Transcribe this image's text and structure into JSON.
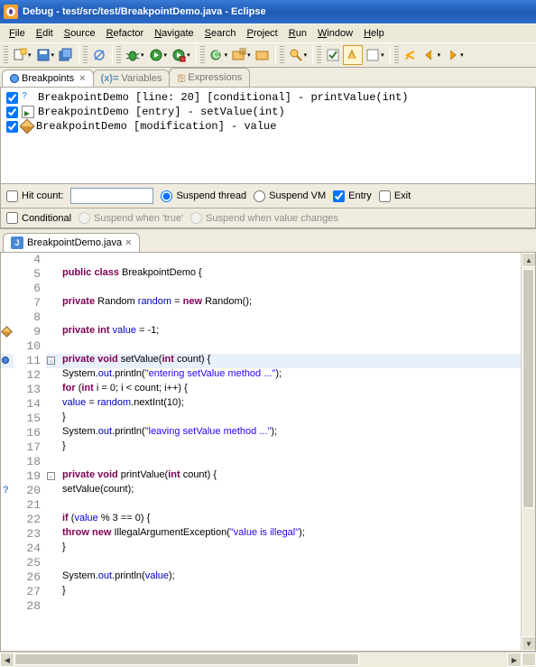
{
  "title": "Debug - test/src/test/BreakpointDemo.java - Eclipse",
  "menus": [
    "File",
    "Edit",
    "Source",
    "Refactor",
    "Navigate",
    "Search",
    "Project",
    "Run",
    "Window",
    "Help"
  ],
  "views": {
    "breakpoints": {
      "label": "Breakpoints",
      "active": true
    },
    "variables": {
      "label": "Variables"
    },
    "expressions": {
      "label": "Expressions"
    }
  },
  "breakpoints_list": [
    {
      "checked": true,
      "icon": "question",
      "text": "BreakpointDemo [line: 20] [conditional] - printValue(int)"
    },
    {
      "checked": true,
      "icon": "entry",
      "text": "BreakpointDemo [entry] - setValue(int)"
    },
    {
      "checked": true,
      "icon": "pencil",
      "text": "BreakpointDemo [modification] - value"
    }
  ],
  "bp_options": {
    "hit_count_label": "Hit count:",
    "hit_count_checked": false,
    "hit_count_value": "",
    "suspend_thread_label": "Suspend thread",
    "suspend_thread_selected": true,
    "suspend_vm_label": "Suspend VM",
    "suspend_vm_selected": false,
    "entry_label": "Entry",
    "entry_checked": true,
    "exit_label": "Exit",
    "exit_checked": false,
    "conditional_label": "Conditional",
    "conditional_checked": false,
    "suspend_true_label": "Suspend when 'true'",
    "suspend_change_label": "Suspend when value changes"
  },
  "editor_tab": {
    "label": "BreakpointDemo.java",
    "close": "×"
  },
  "code_lines": [
    {
      "n": 4,
      "marker": "",
      "tokens": []
    },
    {
      "n": 5,
      "marker": "",
      "tokens": [
        {
          "c": "kw",
          "t": "public class"
        },
        {
          "t": " BreakpointDemo {"
        }
      ]
    },
    {
      "n": 6,
      "marker": "",
      "tokens": []
    },
    {
      "n": 7,
      "marker": "",
      "tokens": [
        {
          "t": "    "
        },
        {
          "c": "kw",
          "t": "private"
        },
        {
          "t": " Random "
        },
        {
          "c": "fld",
          "t": "random"
        },
        {
          "t": " = "
        },
        {
          "c": "kw",
          "t": "new"
        },
        {
          "t": " Random();"
        }
      ]
    },
    {
      "n": 8,
      "marker": "",
      "tokens": []
    },
    {
      "n": 9,
      "marker": "pencilm",
      "tokens": [
        {
          "t": "    "
        },
        {
          "c": "kw",
          "t": "private int"
        },
        {
          "t": " "
        },
        {
          "c": "fld",
          "t": "value"
        },
        {
          "t": " = -1;"
        }
      ]
    },
    {
      "n": 10,
      "marker": "",
      "tokens": []
    },
    {
      "n": 11,
      "marker": "bpmark",
      "hl": true,
      "fold": true,
      "tokens": [
        {
          "t": "    "
        },
        {
          "c": "kw",
          "t": "private void"
        },
        {
          "t": " setValue("
        },
        {
          "c": "kw",
          "t": "int"
        },
        {
          "t": " count) {"
        }
      ]
    },
    {
      "n": 12,
      "marker": "",
      "tokens": [
        {
          "t": "        System."
        },
        {
          "c": "fld",
          "t": "out"
        },
        {
          "t": ".println("
        },
        {
          "c": "str",
          "t": "\"entering setValue method ...\""
        },
        {
          "t": ");"
        }
      ]
    },
    {
      "n": 13,
      "marker": "",
      "tokens": [
        {
          "t": "        "
        },
        {
          "c": "kw",
          "t": "for"
        },
        {
          "t": " ("
        },
        {
          "c": "kw",
          "t": "int"
        },
        {
          "t": " i = 0; i < count; i++) {"
        }
      ]
    },
    {
      "n": 14,
      "marker": "",
      "tokens": [
        {
          "t": "            "
        },
        {
          "c": "fld",
          "t": "value"
        },
        {
          "t": " = "
        },
        {
          "c": "fld",
          "t": "random"
        },
        {
          "t": ".nextInt(10);"
        }
      ]
    },
    {
      "n": 15,
      "marker": "",
      "tokens": [
        {
          "t": "        }"
        }
      ]
    },
    {
      "n": 16,
      "marker": "",
      "tokens": [
        {
          "t": "        System."
        },
        {
          "c": "fld",
          "t": "out"
        },
        {
          "t": ".println("
        },
        {
          "c": "str",
          "t": "\"leaving setValue method ...\""
        },
        {
          "t": ");"
        }
      ]
    },
    {
      "n": 17,
      "marker": "",
      "tokens": [
        {
          "t": "    }"
        }
      ]
    },
    {
      "n": 18,
      "marker": "",
      "tokens": []
    },
    {
      "n": 19,
      "marker": "",
      "fold": true,
      "tokens": [
        {
          "t": "    "
        },
        {
          "c": "kw",
          "t": "private void"
        },
        {
          "t": " printValue("
        },
        {
          "c": "kw",
          "t": "int"
        },
        {
          "t": " count) {"
        }
      ]
    },
    {
      "n": 20,
      "marker": "qmark",
      "tokens": [
        {
          "t": "        setValue(count);"
        }
      ]
    },
    {
      "n": 21,
      "marker": "",
      "tokens": []
    },
    {
      "n": 22,
      "marker": "",
      "tokens": [
        {
          "t": "        "
        },
        {
          "c": "kw",
          "t": "if"
        },
        {
          "t": " ("
        },
        {
          "c": "fld",
          "t": "value"
        },
        {
          "t": " % 3 == 0) {"
        }
      ]
    },
    {
      "n": 23,
      "marker": "",
      "tokens": [
        {
          "t": "            "
        },
        {
          "c": "kw",
          "t": "throw new"
        },
        {
          "t": " IllegalArgumentException("
        },
        {
          "c": "str",
          "t": "\"value is illegal\""
        },
        {
          "t": ");"
        }
      ]
    },
    {
      "n": 24,
      "marker": "",
      "tokens": [
        {
          "t": "        }"
        }
      ]
    },
    {
      "n": 25,
      "marker": "",
      "tokens": []
    },
    {
      "n": 26,
      "marker": "",
      "tokens": [
        {
          "t": "        System."
        },
        {
          "c": "fld",
          "t": "out"
        },
        {
          "t": ".println("
        },
        {
          "c": "fld",
          "t": "value"
        },
        {
          "t": ");"
        }
      ]
    },
    {
      "n": 27,
      "marker": "",
      "tokens": [
        {
          "t": "    }"
        }
      ]
    },
    {
      "n": 28,
      "marker": "",
      "tokens": []
    }
  ]
}
